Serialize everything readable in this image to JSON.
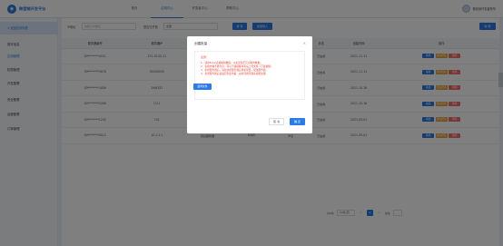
{
  "app": {
    "brand": "微营销开发平台",
    "logo_glyph": "◉"
  },
  "nav": {
    "items": [
      "首页",
      "应用中心",
      "开发者中心",
      "帮助中心"
    ],
    "active_index": 1
  },
  "user": {
    "name": "微营销开发者账号"
  },
  "sidebar": {
    "back_label": "< 返回应用列表",
    "items": [
      "基本信息",
      "应用管理",
      "权限管理",
      "开发配置",
      "安全配置",
      "运营配置",
      "订单管理"
    ],
    "active_index": 1
  },
  "filter": {
    "name_label": "IP地址",
    "name_placeholder": "请输入IP地址",
    "status_label": "是否已开放",
    "status_value": "全部",
    "search_label": "搜 索",
    "reset_label": "批量导入",
    "add_label": "新 增"
  },
  "table": {
    "columns": [
      "服务器编号",
      "服务器IP",
      "服务器名称",
      "服务器端口",
      "所属区域",
      "状态",
      "创建时间",
      "操作"
    ],
    "rows": [
      {
        "c1": "00********4521",
        "c2": "172.10.20.11",
        "c3": "服务器A",
        "c4": "8080",
        "c5": "华东",
        "c6": "已启用",
        "c7": "2021-11-11"
      },
      {
        "c1": "00********5678",
        "c2": "00000000",
        "c3": "服务器B",
        "c4": "8081",
        "c5": "华北",
        "c6": "已启用",
        "c7": "2021-11-11"
      },
      {
        "c1": "00********3456",
        "c2": "29/6152",
        "c3": "服务器C",
        "c4": "8082",
        "c5": "华南",
        "c6": "已启用",
        "c7": "2021-10-18"
      },
      {
        "c1": "00********2456",
        "c2": "1111",
        "c3": "服务器D",
        "c4": "8083",
        "c5": "西南",
        "c6": "已启用",
        "c7": "2021-10-18"
      },
      {
        "c1": "00********1245",
        "c2": "101",
        "c3": "服务器E",
        "c4": "8084",
        "c5": "华中",
        "c6": "已启用",
        "c7": "2021-09-01"
      },
      {
        "c1": "00********0012",
        "c2": "10.1.1.1",
        "c3": "测试服务器",
        "c4": "8085",
        "c5": "华东",
        "c6": "已启用",
        "c7": "2021-09-01"
      }
    ],
    "ops": {
      "edit": "编辑",
      "sub": "修改密码",
      "del": "删除"
    }
  },
  "pager": {
    "total": "共6条",
    "page_size": "10条/页",
    "current": "1",
    "prev": "<",
    "next": ">",
    "goto": "前往"
  },
  "dialog": {
    "title": "创建批量",
    "close": "×",
    "notice_title": "注意：",
    "notice_lines": [
      "1、请用Excel表格编辑数据，以免出现不可识别的数据；",
      "2、表格内容不能为空，可以下载模板填写后上传文件（下载模板）",
      "3、新增服务器后，请在新增服务器后重新配置，配置服务器。",
      "4、新增服务器后请返回列表查看，如有问题可联系客服处理。"
    ],
    "template_label": "选择文件",
    "cancel_label": "取 消",
    "ok_label": "确 定"
  },
  "colors": {
    "accent": "#2d7be5",
    "warning": "#e6a23c",
    "danger": "#f56c6c",
    "notice": "#e0463a"
  }
}
